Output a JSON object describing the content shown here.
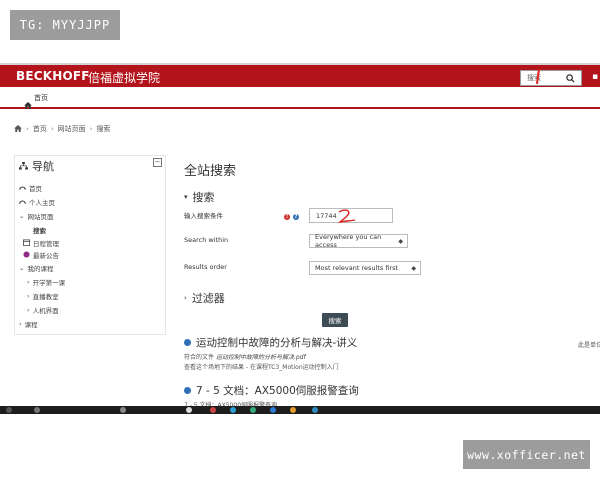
{
  "watermarks": {
    "top_left": "TG: MYYJJPP",
    "bottom_right": "www.xofficer.net"
  },
  "header": {
    "logo": "BECKHOFF",
    "site_name": "倍福虚拟学院",
    "search_value": "搜索",
    "nav_home": "首页"
  },
  "breadcrumb": [
    "首页",
    "网站页面",
    "搜索"
  ],
  "navigation": {
    "title": "导航",
    "items": [
      {
        "label": "首页"
      },
      {
        "label": "个人主页"
      },
      {
        "label": "网站页面"
      },
      {
        "label": "搜索"
      },
      {
        "label": "日程管理"
      },
      {
        "label": "最新公告"
      },
      {
        "label": "我的课程"
      },
      {
        "label": "开学第一课"
      },
      {
        "label": "直播教室"
      },
      {
        "label": "人机界面"
      },
      {
        "label": "课程"
      }
    ]
  },
  "main": {
    "title": "全站搜索",
    "search_section": "搜索",
    "field_label": "输入搜索条件",
    "field_value": "17744",
    "within_label": "Search within",
    "within_value": "Everywhere you can access",
    "order_label": "Results order",
    "order_value": "Most relevant results first",
    "filter_section": "过滤器",
    "submit_label": "搜索"
  },
  "results": [
    {
      "title": "运动控制中故障的分析与解决-讲义",
      "line1_prefix": "符合的文件",
      "line1_file": "运动控制中故障的分析与解决.pdf",
      "line2": "查看这个场地下的结果 - 在课程TC3_Motion运动控制入门",
      "right_text": "此是单位"
    },
    {
      "title": "7 - 5 文档：AX5000伺服报警查询",
      "line1": "7 - 5 文档：AX5000伺服报警查询"
    }
  ],
  "colors": {
    "brand_red": "#b3131b",
    "button_dark": "#3d4b55",
    "result_dot": "#2f6fb3"
  }
}
